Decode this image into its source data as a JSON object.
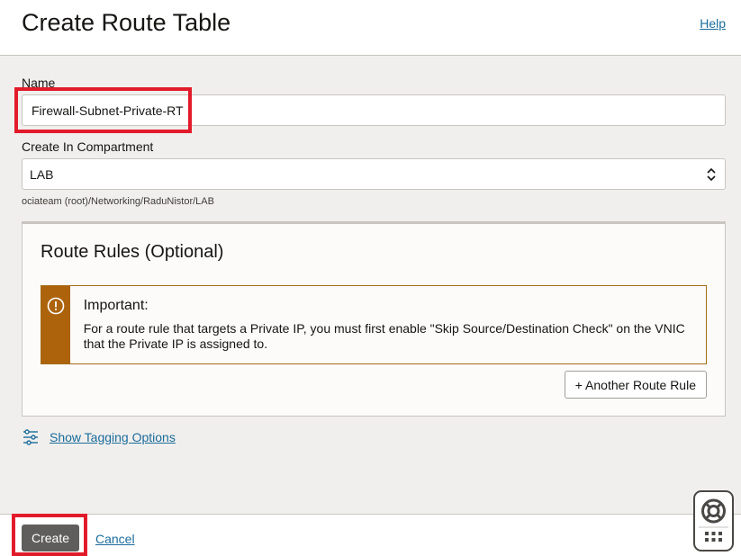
{
  "header": {
    "title": "Create Route Table",
    "help_label": "Help"
  },
  "form": {
    "name_label": "Name",
    "name_value": "Firewall-Subnet-Private-RT",
    "compartment_label": "Create In Compartment",
    "compartment_value": "LAB",
    "compartment_path": "ociateam (root)/Networking/RaduNistor/LAB"
  },
  "route_rules": {
    "title": "Route Rules (Optional)",
    "notice_heading": "Important:",
    "notice_text": "For a route rule that targets a Private IP, you must first enable \"Skip Source/Destination Check\" on the VNIC that the Private IP is assigned to.",
    "add_button_label": "+ Another Route Rule"
  },
  "tagging": {
    "link_label": "Show Tagging Options",
    "icon": "sliders-icon"
  },
  "footer": {
    "create_label": "Create",
    "cancel_label": "Cancel"
  },
  "widget": {
    "icon_top": "lifebuoy-icon",
    "icon_bottom": "grid-icon"
  },
  "colors": {
    "highlight": "#e21b2b",
    "link": "#1b6c9b",
    "notice_accent": "#ac630c",
    "primary_button": "#5f5e5c"
  }
}
